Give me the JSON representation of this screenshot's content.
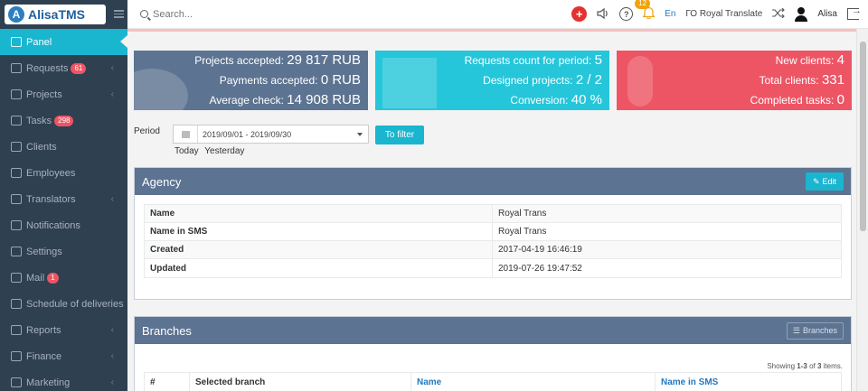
{
  "app": {
    "logo": "AlisaTMS",
    "logo_mark": "A"
  },
  "topbar": {
    "search_placeholder": "Search...",
    "plus": "+",
    "volume_icon": "volume-icon",
    "help": "?",
    "notifications_count": "12",
    "language": "En",
    "organization": "ГО Royal Translate",
    "user": "Alisa"
  },
  "sidebar": {
    "items": [
      {
        "label": "Panel",
        "active": true,
        "badge": "",
        "chevron": false
      },
      {
        "label": "Requests",
        "badge": "61",
        "chevron": true
      },
      {
        "label": "Projects",
        "badge": "",
        "chevron": true
      },
      {
        "label": "Tasks",
        "badge": "298",
        "chevron": false
      },
      {
        "label": "Clients",
        "badge": "",
        "chevron": false
      },
      {
        "label": "Employees",
        "badge": "",
        "chevron": false
      },
      {
        "label": "Translators",
        "badge": "",
        "chevron": true
      },
      {
        "label": "Notifications",
        "badge": "",
        "chevron": false
      },
      {
        "label": "Settings",
        "badge": "",
        "chevron": false
      },
      {
        "label": "Mail",
        "badge": "1",
        "chevron": false
      },
      {
        "label": "Schedule of deliveries",
        "badge": "",
        "chevron": false
      },
      {
        "label": "Reports",
        "badge": "",
        "chevron": true
      },
      {
        "label": "Finance",
        "badge": "",
        "chevron": true
      },
      {
        "label": "Marketing",
        "badge": "",
        "chevron": true
      }
    ]
  },
  "stats": {
    "card1": {
      "color": "#5c7391",
      "lines": [
        {
          "label": "Projects accepted:",
          "value": "29 817 RUB"
        },
        {
          "label": "Payments accepted:",
          "value": "0 RUB"
        },
        {
          "label": "Average check:",
          "value": "14 908 RUB"
        }
      ]
    },
    "card2": {
      "color": "#26c6da",
      "lines": [
        {
          "label": "Requests count for period:",
          "value": "5"
        },
        {
          "label": "Designed projects:",
          "value": "2 / 2"
        },
        {
          "label": "Conversion:",
          "value": "40 %"
        }
      ]
    },
    "card3": {
      "color": "#ed5565",
      "lines": [
        {
          "label": "New clients:",
          "value": "4"
        },
        {
          "label": "Total clients:",
          "value": "331"
        },
        {
          "label": "Completed tasks:",
          "value": "0"
        }
      ]
    }
  },
  "filter": {
    "period_label": "Period",
    "date_range": "2019/09/01 - 2019/09/30",
    "button": "To filter",
    "today": "Today",
    "yesterday": "Yesterday"
  },
  "agency": {
    "title": "Agency",
    "edit": "Edit",
    "rows": [
      {
        "key": "Name",
        "value": "Royal Trans"
      },
      {
        "key": "Name in SMS",
        "value": "Royal Trans"
      },
      {
        "key": "Created",
        "value": "2017-04-19 16:46:19"
      },
      {
        "key": "Updated",
        "value": "2019-07-26 19:47:52"
      }
    ]
  },
  "branches": {
    "title": "Branches",
    "button": "Branches",
    "showing_prefix": "Showing",
    "showing_range": "1-3",
    "showing_of": "of",
    "showing_total": "3",
    "showing_suffix": "items.",
    "columns": [
      "#",
      "Selected branch",
      "Name",
      "Name in SMS"
    ]
  },
  "colors": {
    "sidebar_bg": "#2f4050",
    "accent": "#1ab5cf",
    "panel_head": "#5c7391",
    "danger": "#ed5565",
    "link": "#1f7ac6"
  }
}
